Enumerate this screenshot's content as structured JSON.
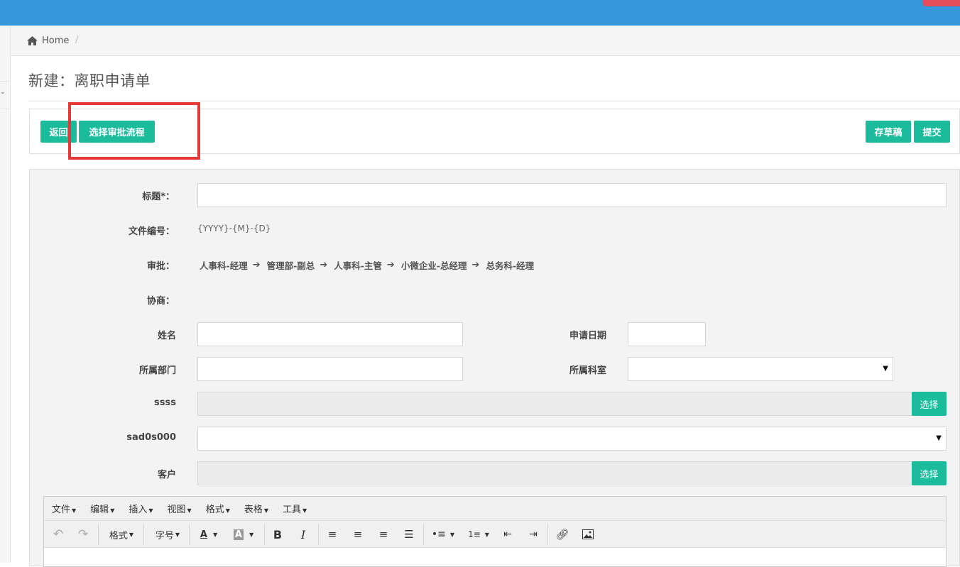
{
  "breadcrumb": {
    "home": "Home",
    "separator": "/"
  },
  "page": {
    "title": "新建：离职申请单"
  },
  "toolbar": {
    "back": "返回",
    "select_flow": "选择审批流程",
    "save_draft": "存草稿",
    "submit": "提交"
  },
  "form": {
    "title_label": "标题*：",
    "doc_no_label": "文件编号：",
    "doc_no_value": "{YYYY}-{M}-{D}",
    "approval_label": "审批：",
    "approval_steps": [
      "人事科-经理",
      "管理部-副总",
      "人事科-主管",
      "小微企业-总经理",
      "总务科-经理"
    ],
    "negotiate_label": "协商：",
    "name_label": "姓名",
    "apply_date_label": "申请日期",
    "dept_label": "所属部门",
    "section_label": "所属科室",
    "ssss_label": "ssss",
    "ssss_button": "选择",
    "sad_label": "sad0s000",
    "customer_label": "客户",
    "customer_button": "选择"
  },
  "editor": {
    "menus": [
      "文件",
      "编辑",
      "插入",
      "视图",
      "格式",
      "表格",
      "工具"
    ],
    "format_dropdown": "格式",
    "fontsize_dropdown": "字号"
  },
  "colors": {
    "topbar": "#3498db",
    "accent": "#1abc9c",
    "highlight": "#e53935"
  }
}
